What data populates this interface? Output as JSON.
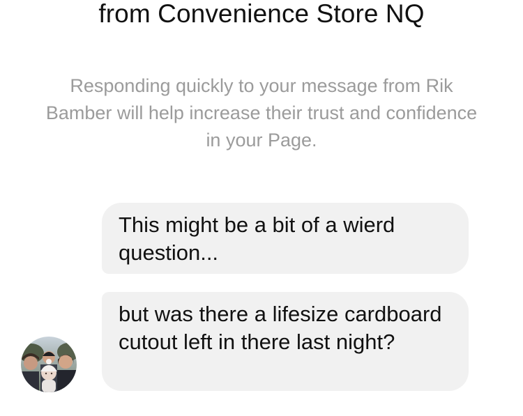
{
  "header": {
    "title": "from Convenience Store NQ"
  },
  "notice": {
    "text": "Responding quickly to your message from Rik Bamber will help increase their trust and confidence in your Page."
  },
  "messages": [
    {
      "text": "This might be a bit of a wierd question..."
    },
    {
      "text": "but was there a lifesize cardboard cutout left in there last night?"
    }
  ],
  "sender": {
    "avatar": "group-photo-avatar"
  },
  "colors": {
    "bubble_bg": "#f1f1f1",
    "notice_text": "#9b9b9b",
    "primary_text": "#111111"
  }
}
